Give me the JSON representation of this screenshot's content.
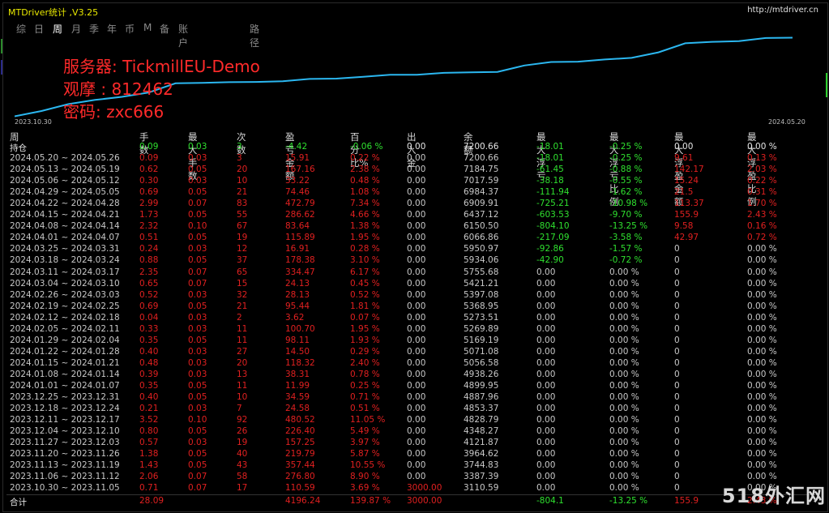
{
  "window": {
    "title": "MTDriver统计 ,V3.25",
    "url": "http://mtdriver.cn"
  },
  "tabs": [
    "综",
    "日",
    "周",
    "月",
    "季",
    "年",
    "币",
    "M",
    "备",
    "账户",
    "路径"
  ],
  "active_tab": "周",
  "overlay": {
    "line1": "服务器: TickmillEU-Demo",
    "line2": "观摩 : 812462",
    "line3": "密码: zxc666"
  },
  "chart": {
    "start_date": "2023.10.30",
    "end_date": "2024.05.20",
    "line_color": "#2bb7f0",
    "balance": [
      3110.59,
      3387.39,
      3744.83,
      3964.62,
      4121.87,
      4348.27,
      4828.79,
      4853.37,
      4887.96,
      4899.95,
      4938.26,
      5056.58,
      5071.08,
      5169.19,
      5269.89,
      5273.51,
      5368.95,
      5397.08,
      5421.21,
      5755.68,
      5934.06,
      5950.97,
      6066.86,
      6150.5,
      6437.12,
      6909.91,
      6984.37,
      7017.59,
      7184.75,
      7200.66
    ]
  },
  "headers": {
    "week": "周",
    "lots": "手数",
    "max_lots": "最大手数",
    "count": "次数",
    "pnl": "盈亏金额",
    "pct": "百分比%",
    "inout": "出入金",
    "balance": "余额",
    "max_float_loss": "最大浮亏",
    "max_float_loss_pct": "最大浮亏比例",
    "max_float_profit": "最大浮盈金额",
    "max_float_profit_pct": "最大浮盈比例"
  },
  "position_row": {
    "label": "持仓",
    "lots": "0.09",
    "max_lots": "0.03",
    "count": "3",
    "pnl": "-4.42",
    "pct": "-0.06 %",
    "inout": "0.00",
    "balance": "7200.66",
    "mfl": "-18.01",
    "mflp": "-0.25 %",
    "mfp": "0.00",
    "mfpp": "0.00 %"
  },
  "rows": [
    [
      "2024.05.20 ~ 2024.05.26",
      "0.09",
      "0.03",
      "3",
      "15.91",
      "0.22 %",
      "0.00",
      "7200.66",
      "-18.01",
      "-0.25 %",
      "9.61",
      "0.13 %"
    ],
    [
      "2024.05.13 ~ 2024.05.19",
      "0.62",
      "0.05",
      "20",
      "167.16",
      "2.38 %",
      "0.00",
      "7184.75",
      "-61.45",
      "-0.88 %",
      "142.17",
      "2.03 %"
    ],
    [
      "2024.05.06 ~ 2024.05.12",
      "0.30",
      "0.03",
      "10",
      "33.22",
      "0.48 %",
      "0.00",
      "7017.59",
      "-38.18",
      "-0.55 %",
      "15.24",
      "0.22 %"
    ],
    [
      "2024.04.29 ~ 2024.05.05",
      "0.69",
      "0.05",
      "21",
      "74.46",
      "1.08 %",
      "0.00",
      "6984.37",
      "-111.94",
      "-1.62 %",
      "21.5",
      "0.31 %"
    ],
    [
      "2024.04.22 ~ 2024.04.28",
      "2.99",
      "0.07",
      "83",
      "472.79",
      "7.34 %",
      "0.00",
      "6909.91",
      "-725.21",
      "-10.98 %",
      "113.37",
      "1.70 %"
    ],
    [
      "2024.04.15 ~ 2024.04.21",
      "1.73",
      "0.05",
      "55",
      "286.62",
      "4.66 %",
      "0.00",
      "6437.12",
      "-603.53",
      "-9.70 %",
      "155.9",
      "2.43 %"
    ],
    [
      "2024.04.08 ~ 2024.04.14",
      "2.32",
      "0.10",
      "67",
      "83.64",
      "1.38 %",
      "0.00",
      "6150.50",
      "-804.10",
      "-13.25 %",
      "9.58",
      "0.16 %"
    ],
    [
      "2024.04.01 ~ 2024.04.07",
      "0.51",
      "0.05",
      "19",
      "115.89",
      "1.95 %",
      "0.00",
      "6066.86",
      "-217.09",
      "-3.58 %",
      "42.97",
      "0.72 %"
    ],
    [
      "2024.03.25 ~ 2024.03.31",
      "0.24",
      "0.03",
      "12",
      "16.91",
      "0.28 %",
      "0.00",
      "5950.97",
      "-92.86",
      "-1.57 %",
      "0",
      "0.00 %"
    ],
    [
      "2024.03.18 ~ 2024.03.24",
      "0.88",
      "0.05",
      "37",
      "178.38",
      "3.10 %",
      "0.00",
      "5934.06",
      "-42.90",
      "-0.72 %",
      "0",
      "0.00 %"
    ],
    [
      "2024.03.11 ~ 2024.03.17",
      "2.35",
      "0.07",
      "65",
      "334.47",
      "6.17 %",
      "0.00",
      "5755.68",
      "0.00",
      "0.00 %",
      "0",
      "0.00 %"
    ],
    [
      "2024.03.04 ~ 2024.03.10",
      "0.65",
      "0.07",
      "15",
      "24.13",
      "0.45 %",
      "0.00",
      "5421.21",
      "0.00",
      "0.00 %",
      "0",
      "0.00 %"
    ],
    [
      "2024.02.26 ~ 2024.03.03",
      "0.52",
      "0.03",
      "32",
      "28.13",
      "0.52 %",
      "0.00",
      "5397.08",
      "0.00",
      "0.00 %",
      "0",
      "0.00 %"
    ],
    [
      "2024.02.19 ~ 2024.02.25",
      "0.69",
      "0.05",
      "21",
      "95.44",
      "1.81 %",
      "0.00",
      "5368.95",
      "0.00",
      "0.00 %",
      "0",
      "0.00 %"
    ],
    [
      "2024.02.12 ~ 2024.02.18",
      "0.04",
      "0.03",
      "2",
      "3.62",
      "0.07 %",
      "0.00",
      "5273.51",
      "0.00",
      "0.00 %",
      "0",
      "0.00 %"
    ],
    [
      "2024.02.05 ~ 2024.02.11",
      "0.33",
      "0.03",
      "11",
      "100.70",
      "1.95 %",
      "0.00",
      "5269.89",
      "0.00",
      "0.00 %",
      "0",
      "0.00 %"
    ],
    [
      "2024.01.29 ~ 2024.02.04",
      "0.35",
      "0.05",
      "11",
      "98.11",
      "1.93 %",
      "0.00",
      "5169.19",
      "0.00",
      "0.00 %",
      "0",
      "0.00 %"
    ],
    [
      "2024.01.22 ~ 2024.01.28",
      "0.40",
      "0.03",
      "27",
      "14.50",
      "0.29 %",
      "0.00",
      "5071.08",
      "0.00",
      "0.00 %",
      "0",
      "0.00 %"
    ],
    [
      "2024.01.15 ~ 2024.01.21",
      "0.48",
      "0.03",
      "20",
      "118.32",
      "2.40 %",
      "0.00",
      "5056.58",
      "0.00",
      "0.00 %",
      "0",
      "0.00 %"
    ],
    [
      "2024.01.08 ~ 2024.01.14",
      "0.39",
      "0.03",
      "13",
      "38.31",
      "0.78 %",
      "0.00",
      "4938.26",
      "0.00",
      "0.00 %",
      "0",
      "0.00 %"
    ],
    [
      "2024.01.01 ~ 2024.01.07",
      "0.35",
      "0.05",
      "11",
      "11.99",
      "0.25 %",
      "0.00",
      "4899.95",
      "0.00",
      "0.00 %",
      "0",
      "0.00 %"
    ],
    [
      "2023.12.25 ~ 2023.12.31",
      "0.40",
      "0.05",
      "10",
      "34.59",
      "0.71 %",
      "0.00",
      "4887.96",
      "0.00",
      "0.00 %",
      "0",
      "0.00 %"
    ],
    [
      "2023.12.18 ~ 2023.12.24",
      "0.21",
      "0.03",
      "7",
      "24.58",
      "0.51 %",
      "0.00",
      "4853.37",
      "0.00",
      "0.00 %",
      "0",
      "0.00 %"
    ],
    [
      "2023.12.11 ~ 2023.12.17",
      "3.52",
      "0.10",
      "92",
      "480.52",
      "11.05 %",
      "0.00",
      "4828.79",
      "0.00",
      "0.00 %",
      "0",
      "0.00 %"
    ],
    [
      "2023.12.04 ~ 2023.12.10",
      "0.80",
      "0.05",
      "26",
      "226.40",
      "5.49 %",
      "0.00",
      "4348.27",
      "0.00",
      "0.00 %",
      "0",
      "0.00 %"
    ],
    [
      "2023.11.27 ~ 2023.12.03",
      "0.57",
      "0.03",
      "19",
      "157.25",
      "3.97 %",
      "0.00",
      "4121.87",
      "0.00",
      "0.00 %",
      "0",
      "0.00 %"
    ],
    [
      "2023.11.20 ~ 2023.11.26",
      "1.38",
      "0.05",
      "40",
      "219.79",
      "5.87 %",
      "0.00",
      "3964.62",
      "0.00",
      "0.00 %",
      "0",
      "0.00 %"
    ],
    [
      "2023.11.13 ~ 2023.11.19",
      "1.43",
      "0.05",
      "43",
      "357.44",
      "10.55 %",
      "0.00",
      "3744.83",
      "0.00",
      "0.00 %",
      "0",
      "0.00 %"
    ],
    [
      "2023.11.06 ~ 2023.11.12",
      "2.06",
      "0.07",
      "58",
      "276.80",
      "8.90 %",
      "0.00",
      "3387.39",
      "0.00",
      "0.00 %",
      "0",
      "0.00 %"
    ],
    [
      "2023.10.30 ~ 2023.11.05",
      "0.71",
      "0.07",
      "17",
      "110.59",
      "3.69 %",
      "3000.00",
      "3110.59",
      "0.00",
      "0.00 %",
      "0",
      "0.00 %"
    ]
  ],
  "total_row": {
    "label": "合计",
    "lots": "28.09",
    "pnl": "4196.24",
    "pct": "139.87 %",
    "inout": "3000.00",
    "mfl": "-804.1",
    "mflp": "-13.25 %",
    "mfp": "155.9",
    "mfpp": "2.43 %"
  },
  "watermark": "518外汇网"
}
